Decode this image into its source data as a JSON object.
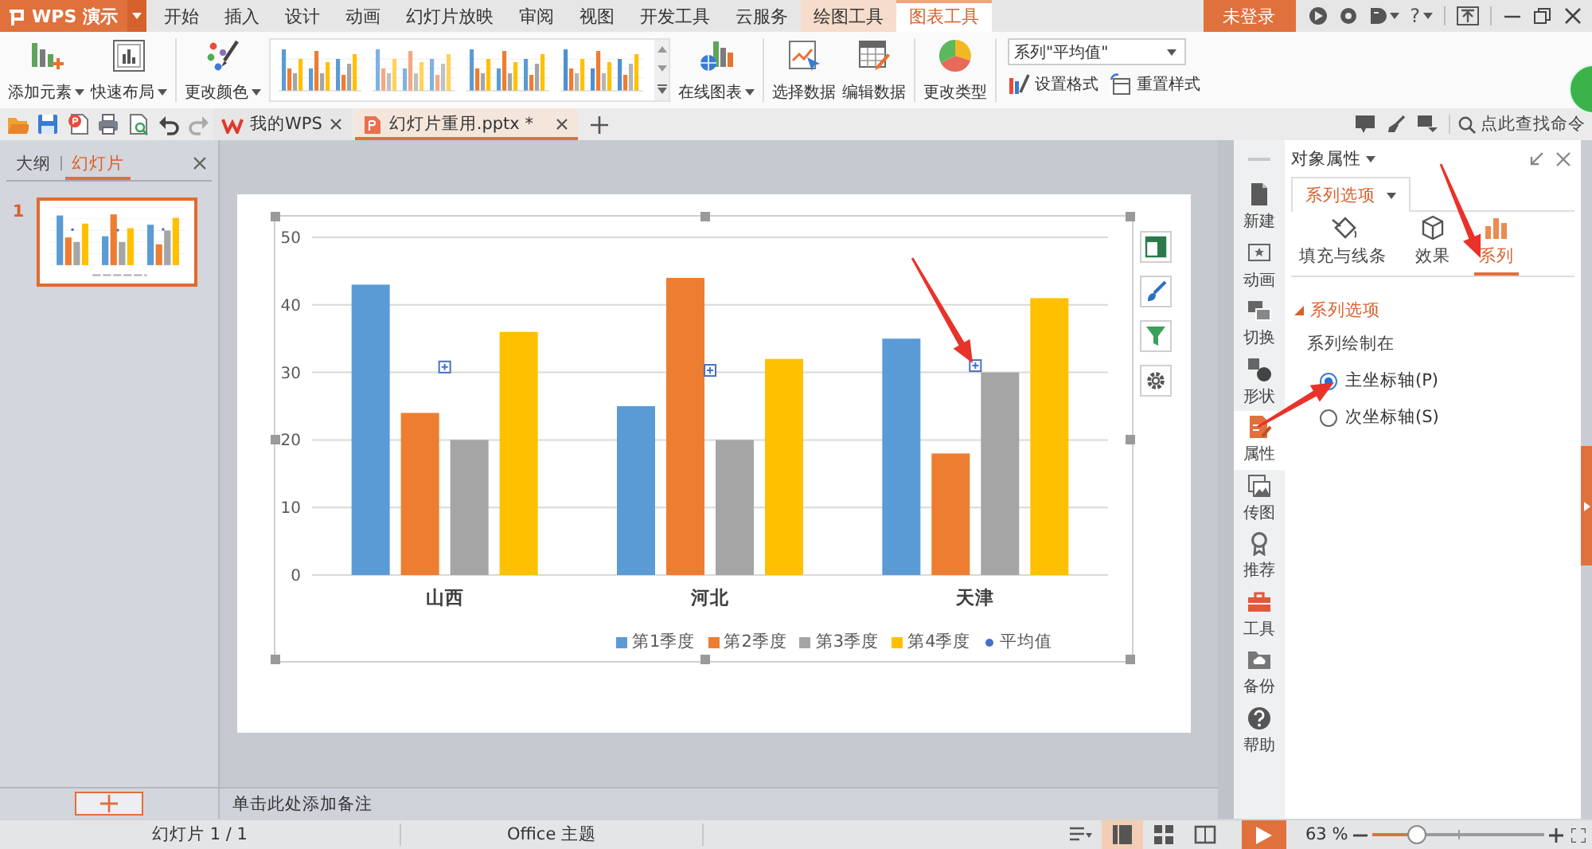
{
  "title_bar": {
    "app_name": "WPS 演示",
    "tabs": [
      {
        "label": "开始",
        "kind": "main",
        "selected": false
      },
      {
        "label": "插入",
        "kind": "main",
        "selected": false
      },
      {
        "label": "设计",
        "kind": "main",
        "selected": false
      },
      {
        "label": "动画",
        "kind": "main",
        "selected": false
      },
      {
        "label": "幻灯片放映",
        "kind": "main",
        "selected": false
      },
      {
        "label": "审阅",
        "kind": "main",
        "selected": false
      },
      {
        "label": "视图",
        "kind": "main",
        "selected": false
      },
      {
        "label": "开发工具",
        "kind": "main",
        "selected": false
      },
      {
        "label": "云服务",
        "kind": "main",
        "selected": false
      },
      {
        "label": "绘图工具",
        "kind": "context",
        "selected": false
      },
      {
        "label": "图表工具",
        "kind": "context",
        "selected": true
      }
    ],
    "login": "未登录",
    "help": "?"
  },
  "ribbon": {
    "groups": [
      {
        "items": [
          {
            "kind": "large",
            "label": "添加元素",
            "has_menu": true
          },
          {
            "kind": "large",
            "label": "快速布局",
            "has_menu": true
          }
        ]
      },
      {
        "items": [
          {
            "kind": "large",
            "label": "更改颜色",
            "has_menu": true
          },
          {
            "kind": "gallery"
          },
          {
            "kind": "large",
            "label": "在线图表",
            "has_menu": true
          }
        ]
      },
      {
        "items": [
          {
            "kind": "large",
            "label": "选择数据",
            "has_menu": false
          },
          {
            "kind": "large",
            "label": "编辑数据",
            "has_menu": false
          }
        ]
      },
      {
        "items": [
          {
            "kind": "large",
            "label": "更改类型",
            "has_menu": false
          }
        ]
      },
      {
        "items": [
          {
            "kind": "stack",
            "select": {
              "value": "系列\"平均值\""
            },
            "buttons": [
              {
                "label": "设置格式"
              },
              {
                "label": "重置样式"
              }
            ]
          }
        ]
      }
    ]
  },
  "doc_bar": {
    "tabs": [
      {
        "kind": "home",
        "label": "我的WPS",
        "selected": false
      },
      {
        "kind": "document",
        "label": "幻灯片重用.pptx *",
        "selected": true
      }
    ],
    "search": {
      "placeholder": "点此查找命令"
    }
  },
  "left_panel": {
    "tabs": [
      {
        "label": "大纲",
        "selected": false
      },
      {
        "label": "幻灯片",
        "selected": true
      }
    ],
    "slides": [
      {
        "number": "1",
        "selected": true
      }
    ]
  },
  "slide": {
    "chart_data": {
      "type": "bar",
      "categories": [
        "山西",
        "河北",
        "天津"
      ],
      "series": [
        {
          "name": "第1季度",
          "color": "#5b9bd5",
          "values": [
            43,
            25,
            35
          ]
        },
        {
          "name": "第2季度",
          "color": "#ed7d31",
          "values": [
            24,
            44,
            18
          ]
        },
        {
          "name": "第3季度",
          "color": "#a5a5a5",
          "values": [
            20,
            20,
            30
          ]
        },
        {
          "name": "第4季度",
          "color": "#ffc000",
          "values": [
            36,
            32,
            41
          ]
        },
        {
          "name": "平均值",
          "type": "line",
          "marker": true,
          "color": "#4472c4",
          "values": [
            30.8,
            30.3,
            31
          ]
        }
      ],
      "ylim": [
        0,
        50
      ],
      "yticks": [
        0,
        10,
        20,
        30,
        40,
        50
      ],
      "grid": true,
      "legend": "bottom"
    }
  },
  "notes": {
    "prompt": "单击此处添加备注"
  },
  "sidebar": {
    "items": [
      {
        "label": "新建",
        "selected": false
      },
      {
        "label": "动画",
        "selected": false
      },
      {
        "label": "切换",
        "selected": false
      },
      {
        "label": "形状",
        "selected": false
      },
      {
        "label": "属性",
        "selected": true
      },
      {
        "label": "传图",
        "selected": false
      },
      {
        "label": "推荐",
        "selected": false
      },
      {
        "label": "工具",
        "selected": false
      },
      {
        "label": "备份",
        "selected": false
      },
      {
        "label": "帮助",
        "selected": false
      }
    ]
  },
  "properties": {
    "title": "对象属性",
    "tabs": [
      {
        "label": "系列选项",
        "selected": true
      }
    ],
    "subtabs": [
      {
        "label": "填充与线条",
        "selected": false
      },
      {
        "label": "效果",
        "selected": false
      },
      {
        "label": "系列",
        "selected": true
      }
    ],
    "section": {
      "title": "系列选项",
      "expanded": true,
      "caption": "系列绘制在",
      "options": [
        {
          "label": "主坐标轴(P)",
          "selected": true
        },
        {
          "label": "次坐标轴(S)",
          "selected": false
        }
      ]
    }
  },
  "status_bar": {
    "slide_info": "幻灯片 1 / 1",
    "theme": "Office 主题",
    "views": [
      {
        "selected": true
      },
      {
        "selected": false
      },
      {
        "selected": false
      }
    ],
    "zoom": {
      "reading": "63 %",
      "level": 0.26
    }
  }
}
